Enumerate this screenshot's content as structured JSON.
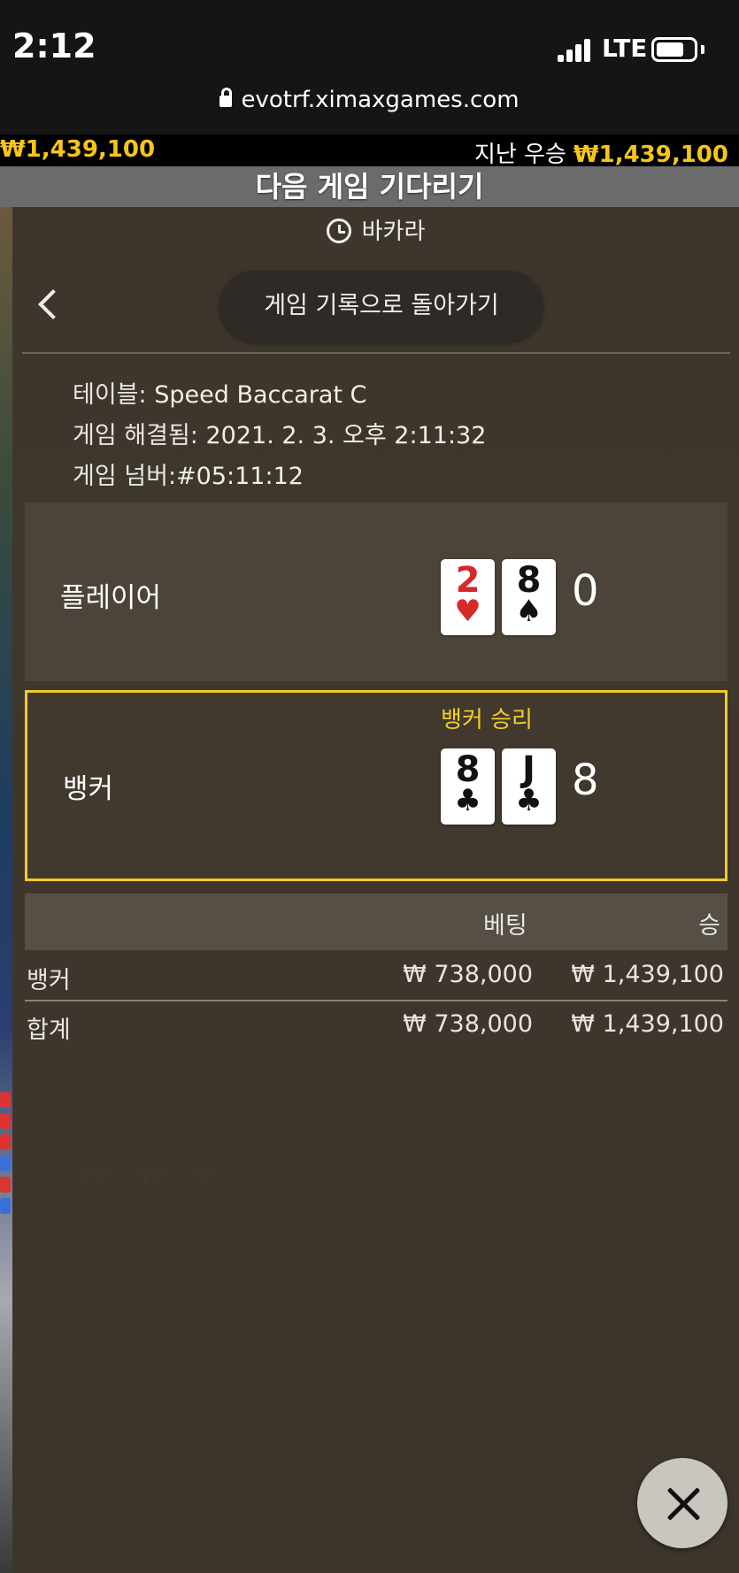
{
  "status_bar": {
    "time": "2:12",
    "network": "LTE"
  },
  "browser": {
    "url": "evotrf.ximaxgames.com"
  },
  "jackpot": {
    "left_amount": "₩1,439,100",
    "last_win_label": "지난 우승",
    "last_win_amount": "₩1,439,100"
  },
  "waiting_banner": "다음 게임 기다리기",
  "panel": {
    "header_title": "바카라",
    "back_button_label": "게임 기록으로 돌아가기",
    "table_label": "테이블:",
    "table_value": "Speed Baccarat C",
    "resolved_label": "게임 해결됨:",
    "resolved_value": "2021. 2. 3. 오후 2:11:32",
    "number_label": "게임 넘버:",
    "number_value": "#05:11:12"
  },
  "player": {
    "label": "플레이어",
    "cards": [
      {
        "rank": "2",
        "suit": "♥",
        "color": "#d42a2a"
      },
      {
        "rank": "8",
        "suit": "♠",
        "color": "#111111"
      }
    ],
    "score": "0"
  },
  "banker": {
    "label": "뱅커",
    "win_label": "뱅커 승리",
    "cards": [
      {
        "rank": "8",
        "suit": "♣",
        "color": "#111111"
      },
      {
        "rank": "J",
        "suit": "♣",
        "color": "#111111"
      }
    ],
    "score": "8",
    "highlight_color": "#f1cc2a"
  },
  "bets": {
    "header_bet": "베팅",
    "header_win": "승",
    "rows": [
      {
        "name": "뱅커",
        "bet": "₩ 738,000",
        "win": "₩ 1,439,100"
      },
      {
        "name": "합계",
        "bet": "₩ 738,000",
        "win": "₩ 1,439,100"
      }
    ]
  },
  "icons": {
    "back": "chevron-left-icon",
    "history": "history-icon",
    "close": "close-icon",
    "lock": "lock-icon"
  }
}
